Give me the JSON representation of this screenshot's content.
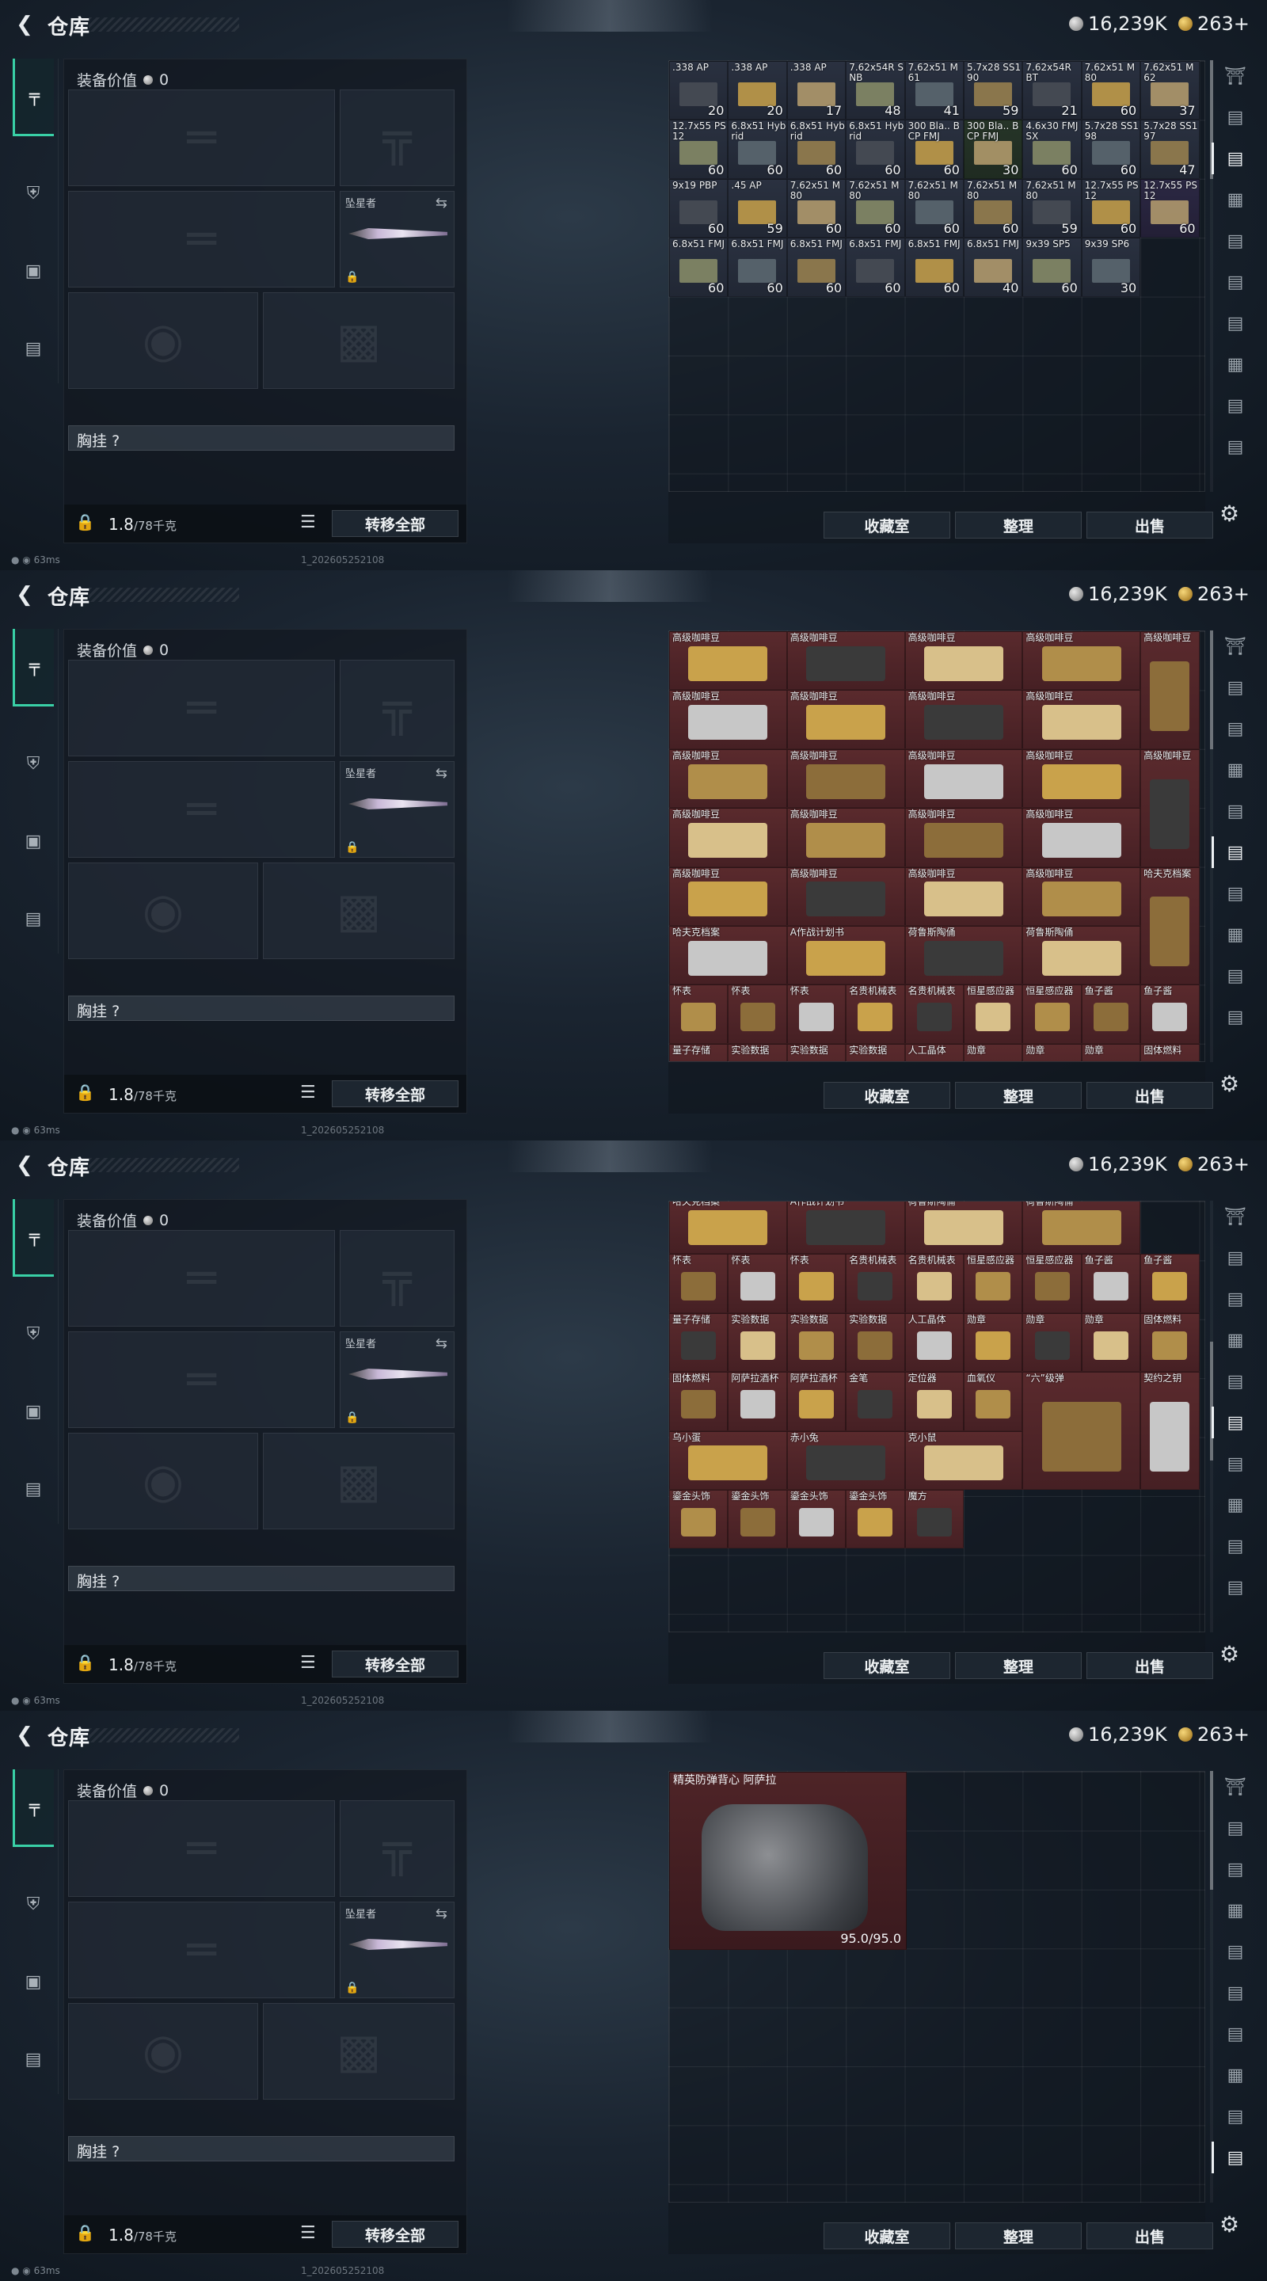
{
  "header": {
    "title": "仓库",
    "silver": "16,239K",
    "gold": "263+"
  },
  "equipment": {
    "value_label": "装备价值",
    "value": "0",
    "melee_name": "坠星者",
    "chest_label": "胸挂",
    "chest_value": "?",
    "weight": "1.8",
    "weight_max": "/78千克",
    "transfer_all": "转移全部"
  },
  "stash_buttons": {
    "collection": "收藏室",
    "sort": "整理",
    "sell": "出售"
  },
  "status": {
    "ping": "63ms",
    "build": "1_202605252108"
  },
  "icons": {
    "back": "back-arrow-icon",
    "weapon_tab": "gun-icon",
    "armor_tab": "armor-icon",
    "backpack_tab": "backpack-icon",
    "case_tab": "briefcase-icon",
    "settings": "gear-icon"
  },
  "colors": {
    "accent": "#39d0a6",
    "loot_bg": "#5a2a2d",
    "ammo_bg": "#2a3140"
  },
  "views": [
    {
      "scroll_thumb": "0.00",
      "items": [
        {
          "n": ".338 AP",
          "q": "20",
          "t": "ammo"
        },
        {
          "n": ".338 AP",
          "q": "20",
          "t": "ammo"
        },
        {
          "n": ".338 AP",
          "q": "17",
          "t": "ammo"
        },
        {
          "n": "7.62x54R SNB",
          "q": "48",
          "t": "ammo"
        },
        {
          "n": "7.62x51 M61",
          "q": "41",
          "t": "ammo"
        },
        {
          "n": "5.7x28 SS190",
          "q": "59",
          "t": "ammo"
        },
        {
          "n": "7.62x54R BT",
          "q": "21",
          "t": "ammo"
        },
        {
          "n": "7.62x51 M80",
          "q": "60",
          "t": "ammo"
        },
        {
          "n": "7.62x51 M62",
          "q": "37",
          "t": "ammo"
        },
        {
          "n": "12.7x55 PS12",
          "q": "60",
          "t": "ammo"
        },
        {
          "n": "6.8x51 Hybrid",
          "q": "60",
          "t": "ammo"
        },
        {
          "n": "6.8x51 Hybrid",
          "q": "60",
          "t": "ammo"
        },
        {
          "n": "6.8x51 Hybrid",
          "q": "60",
          "t": "ammo"
        },
        {
          "n": "300 Bla.. BCP FMJ",
          "q": "60",
          "t": "ammo"
        },
        {
          "n": "300 Bla.. BCP FMJ",
          "q": "30",
          "t": "green"
        },
        {
          "n": "4.6x30 FMJ SX",
          "q": "60",
          "t": "ammo"
        },
        {
          "n": "5.7x28 SS198",
          "q": "60",
          "t": "ammo"
        },
        {
          "n": "5.7x28 SS197",
          "q": "47",
          "t": "ammo"
        },
        {
          "n": "9x19 PBP",
          "q": "60",
          "t": "ammo"
        },
        {
          "n": ".45 AP",
          "q": "59",
          "t": "ammo"
        },
        {
          "n": "7.62x51 M80",
          "q": "60",
          "t": "ammo"
        },
        {
          "n": "7.62x51 M80",
          "q": "60",
          "t": "ammo"
        },
        {
          "n": "7.62x51 M80",
          "q": "60",
          "t": "ammo"
        },
        {
          "n": "7.62x51 M80",
          "q": "60",
          "t": "ammo"
        },
        {
          "n": "7.62x51 M80",
          "q": "59",
          "t": "ammo"
        },
        {
          "n": "12.7x55 PS12",
          "q": "60",
          "t": "ammo"
        },
        {
          "n": "12.7x55 PS12",
          "q": "60",
          "t": "purple"
        },
        {
          "n": "6.8x51 FMJ",
          "q": "60",
          "t": "ammo"
        },
        {
          "n": "6.8x51 FMJ",
          "q": "60",
          "t": "ammo"
        },
        {
          "n": "6.8x51 FMJ",
          "q": "60",
          "t": "ammo"
        },
        {
          "n": "6.8x51 FMJ",
          "q": "60",
          "t": "ammo"
        },
        {
          "n": "6.8x51 FMJ",
          "q": "60",
          "t": "ammo"
        },
        {
          "n": "6.8x51 FMJ",
          "q": "40",
          "t": "ammo"
        },
        {
          "n": "9x39 SP5",
          "q": "60",
          "t": "ammo"
        },
        {
          "n": "9x39 SP6",
          "q": "30",
          "t": "ammo"
        }
      ]
    },
    {
      "scroll_thumb": "0.00",
      "items": [
        {
          "n": "高级咖啡豆",
          "q": "",
          "t": "loot"
        },
        {
          "n": "高级咖啡豆",
          "q": "",
          "t": "loot"
        },
        {
          "n": "高级咖啡豆",
          "q": "",
          "t": "loot"
        },
        {
          "n": "高级咖啡豆",
          "q": "",
          "t": "loot"
        },
        {
          "n": "高级咖啡豆",
          "q": "",
          "t": "loot"
        },
        {
          "n": "高级咖啡豆",
          "q": "",
          "t": "loot"
        },
        {
          "n": "高级咖啡豆",
          "q": "",
          "t": "loot"
        },
        {
          "n": "高级咖啡豆",
          "q": "",
          "t": "loot"
        },
        {
          "n": "高级咖啡豆",
          "q": "",
          "t": "loot"
        },
        {
          "n": "高级咖啡豆",
          "q": "",
          "t": "loot"
        },
        {
          "n": "高级咖啡豆",
          "q": "",
          "t": "loot"
        },
        {
          "n": "高级咖啡豆",
          "q": "",
          "t": "loot"
        },
        {
          "n": "高级咖啡豆",
          "q": "",
          "t": "loot"
        },
        {
          "n": "高级咖啡豆",
          "q": "",
          "t": "loot"
        },
        {
          "n": "高级咖啡豆",
          "q": "",
          "t": "loot"
        },
        {
          "n": "高级咖啡豆",
          "q": "",
          "t": "loot"
        },
        {
          "n": "高级咖啡豆",
          "q": "",
          "t": "loot"
        },
        {
          "n": "高级咖啡豆",
          "q": "",
          "t": "loot"
        },
        {
          "n": "高级咖啡豆",
          "q": "",
          "t": "loot"
        },
        {
          "n": "高级咖啡豆",
          "q": "",
          "t": "loot"
        },
        {
          "n": "高级咖啡豆",
          "q": "",
          "t": "loot"
        },
        {
          "n": "高级咖啡豆",
          "q": "",
          "t": "loot"
        },
        {
          "n": "哈夫克档案",
          "q": "",
          "t": "loot"
        },
        {
          "n": "哈夫克档案",
          "q": "",
          "t": "loot"
        },
        {
          "n": "A作战计划书",
          "q": "",
          "t": "loot"
        },
        {
          "n": "荷鲁斯陶俑",
          "q": "",
          "t": "loot"
        },
        {
          "n": "荷鲁斯陶俑",
          "q": "",
          "t": "loot"
        },
        {
          "n": "怀表",
          "q": "",
          "t": "loot"
        },
        {
          "n": "怀表",
          "q": "",
          "t": "loot"
        },
        {
          "n": "怀表",
          "q": "",
          "t": "loot"
        },
        {
          "n": "名贵机械表",
          "q": "",
          "t": "loot"
        },
        {
          "n": "名贵机械表",
          "q": "",
          "t": "loot"
        },
        {
          "n": "恒星感应器",
          "q": "",
          "t": "loot"
        },
        {
          "n": "恒星感应器",
          "q": "",
          "t": "loot"
        },
        {
          "n": "鱼子酱",
          "q": "",
          "t": "loot"
        },
        {
          "n": "鱼子酱",
          "q": "",
          "t": "loot"
        },
        {
          "n": "量子存储",
          "q": "",
          "t": "loot"
        },
        {
          "n": "实验数据",
          "q": "",
          "t": "loot"
        },
        {
          "n": "实验数据",
          "q": "",
          "t": "loot"
        },
        {
          "n": "实验数据",
          "q": "",
          "t": "loot"
        },
        {
          "n": "人工晶体",
          "q": "",
          "t": "loot"
        },
        {
          "n": "勋章",
          "q": "",
          "t": "loot"
        },
        {
          "n": "勋章",
          "q": "",
          "t": "loot"
        },
        {
          "n": "勋章",
          "q": "",
          "t": "loot"
        },
        {
          "n": "固体燃料",
          "q": "",
          "t": "loot"
        }
      ]
    },
    {
      "scroll_thumb": "0.45",
      "items": [
        {
          "n": "哈夫克档案",
          "q": "",
          "t": "loot"
        },
        {
          "n": "A作战计划书",
          "q": "",
          "t": "loot"
        },
        {
          "n": "荷鲁斯陶俑",
          "q": "",
          "t": "loot"
        },
        {
          "n": "荷鲁斯陶俑",
          "q": "",
          "t": "loot"
        },
        {
          "n": "怀表",
          "q": "",
          "t": "loot"
        },
        {
          "n": "怀表",
          "q": "",
          "t": "loot"
        },
        {
          "n": "怀表",
          "q": "",
          "t": "loot"
        },
        {
          "n": "名贵机械表",
          "q": "",
          "t": "loot"
        },
        {
          "n": "名贵机械表",
          "q": "",
          "t": "loot"
        },
        {
          "n": "恒星感应器",
          "q": "",
          "t": "loot"
        },
        {
          "n": "恒星感应器",
          "q": "",
          "t": "loot"
        },
        {
          "n": "鱼子酱",
          "q": "",
          "t": "loot"
        },
        {
          "n": "鱼子酱",
          "q": "",
          "t": "loot"
        },
        {
          "n": "量子存储",
          "q": "",
          "t": "loot"
        },
        {
          "n": "实验数据",
          "q": "",
          "t": "loot"
        },
        {
          "n": "实验数据",
          "q": "",
          "t": "loot"
        },
        {
          "n": "实验数据",
          "q": "",
          "t": "loot"
        },
        {
          "n": "人工晶体",
          "q": "",
          "t": "loot"
        },
        {
          "n": "勋章",
          "q": "",
          "t": "loot"
        },
        {
          "n": "勋章",
          "q": "",
          "t": "loot"
        },
        {
          "n": "勋章",
          "q": "",
          "t": "loot"
        },
        {
          "n": "固体燃料",
          "q": "",
          "t": "loot"
        },
        {
          "n": "固体燃料",
          "q": "",
          "t": "loot"
        },
        {
          "n": "阿萨拉酒杯",
          "q": "",
          "t": "loot"
        },
        {
          "n": "阿萨拉酒杯",
          "q": "",
          "t": "loot"
        },
        {
          "n": "金笔",
          "q": "",
          "t": "loot"
        },
        {
          "n": "定位器",
          "q": "",
          "t": "loot"
        },
        {
          "n": "血氧仪",
          "q": "",
          "t": "loot"
        },
        {
          "n": "“六”级弹",
          "q": "",
          "t": "loot"
        },
        {
          "n": "契约之钥",
          "q": "",
          "t": "loot"
        },
        {
          "n": "乌小蛋",
          "q": "",
          "t": "loot"
        },
        {
          "n": "赤小兔",
          "q": "",
          "t": "loot"
        },
        {
          "n": "克小鼠",
          "q": "",
          "t": "loot"
        },
        {
          "n": "鎏金头饰",
          "q": "",
          "t": "loot"
        },
        {
          "n": "鎏金头饰",
          "q": "",
          "t": "loot"
        },
        {
          "n": "鎏金头饰",
          "q": "",
          "t": "loot"
        },
        {
          "n": "鎏金头饰",
          "q": "",
          "t": "loot"
        },
        {
          "n": "魔方",
          "q": "",
          "t": "loot"
        }
      ]
    },
    {
      "scroll_thumb": "0.00",
      "vest": {
        "name": "精英防弹背心 阿萨拉",
        "durability": "95.0/95.0"
      }
    }
  ]
}
